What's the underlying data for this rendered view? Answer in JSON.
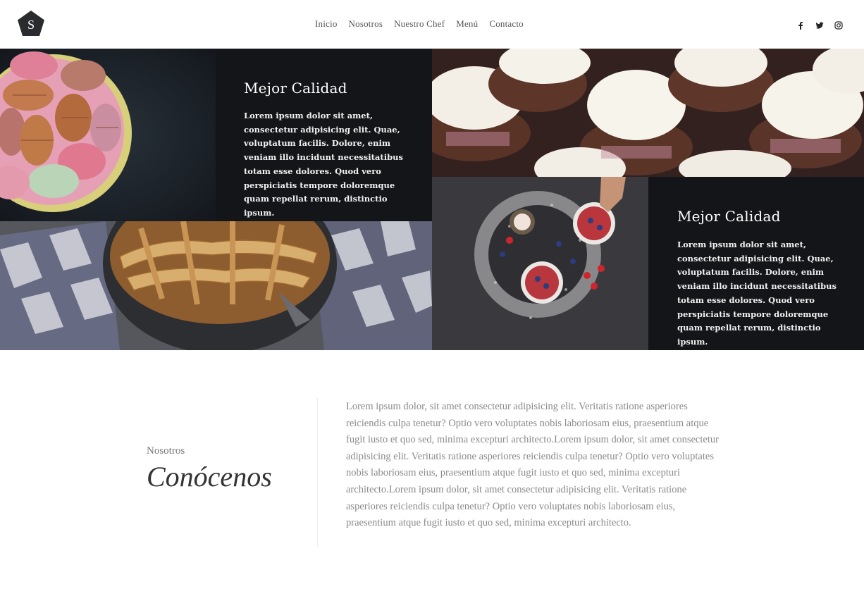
{
  "header": {
    "logo_letter": "S",
    "nav": [
      "Inicio",
      "Nosotros",
      "Nuestro Chef",
      "Menú",
      "Contacto"
    ],
    "social_icons": [
      "facebook-icon",
      "twitter-icon",
      "instagram-icon"
    ]
  },
  "hero": {
    "panel_1": {
      "title": "Mejor Calidad",
      "text": "Lorem ipsum dolor sit amet, consectetur adipisicing elit. Quae, voluptatum facilis. Dolore, enim veniam illo incidunt necessitatibus totam esse dolores. Quod vero perspiciatis tempore doloremque quam repellat rerum, distinctio ipsum."
    },
    "panel_2": {
      "title": "Mejor Calidad",
      "text": "Lorem ipsum dolor sit amet, consectetur adipisicing elit. Quae, voluptatum facilis. Dolore, enim veniam illo incidunt necessitatibus totam esse dolores. Quod vero perspiciatis tempore doloremque quam repellat rerum, distinctio ipsum."
    }
  },
  "about": {
    "kicker": "Nosotros",
    "title": "Conócenos",
    "text": "Lorem ipsum dolor, sit amet consectetur adipisicing elit. Veritatis ratione asperiores reiciendis culpa tenetur? Optio vero voluptates nobis laboriosam eius, praesentium atque fugit iusto et quo sed, minima excepturi architecto.Lorem ipsum dolor, sit amet consectetur adipisicing elit. Veritatis ratione asperiores reiciendis culpa tenetur? Optio vero voluptates nobis laboriosam eius, praesentium atque fugit iusto et quo sed, minima excepturi architecto.Lorem ipsum dolor, sit amet consectetur adipisicing elit. Veritatis ratione asperiores reiciendis culpa tenetur? Optio vero voluptates nobis laboriosam eius, praesentium atque fugit iusto et quo sed, minima excepturi architecto."
  },
  "colors": {
    "dark_panel": "#141518",
    "logo": "#2a2b2e",
    "body_text": "#8a8a8a"
  }
}
